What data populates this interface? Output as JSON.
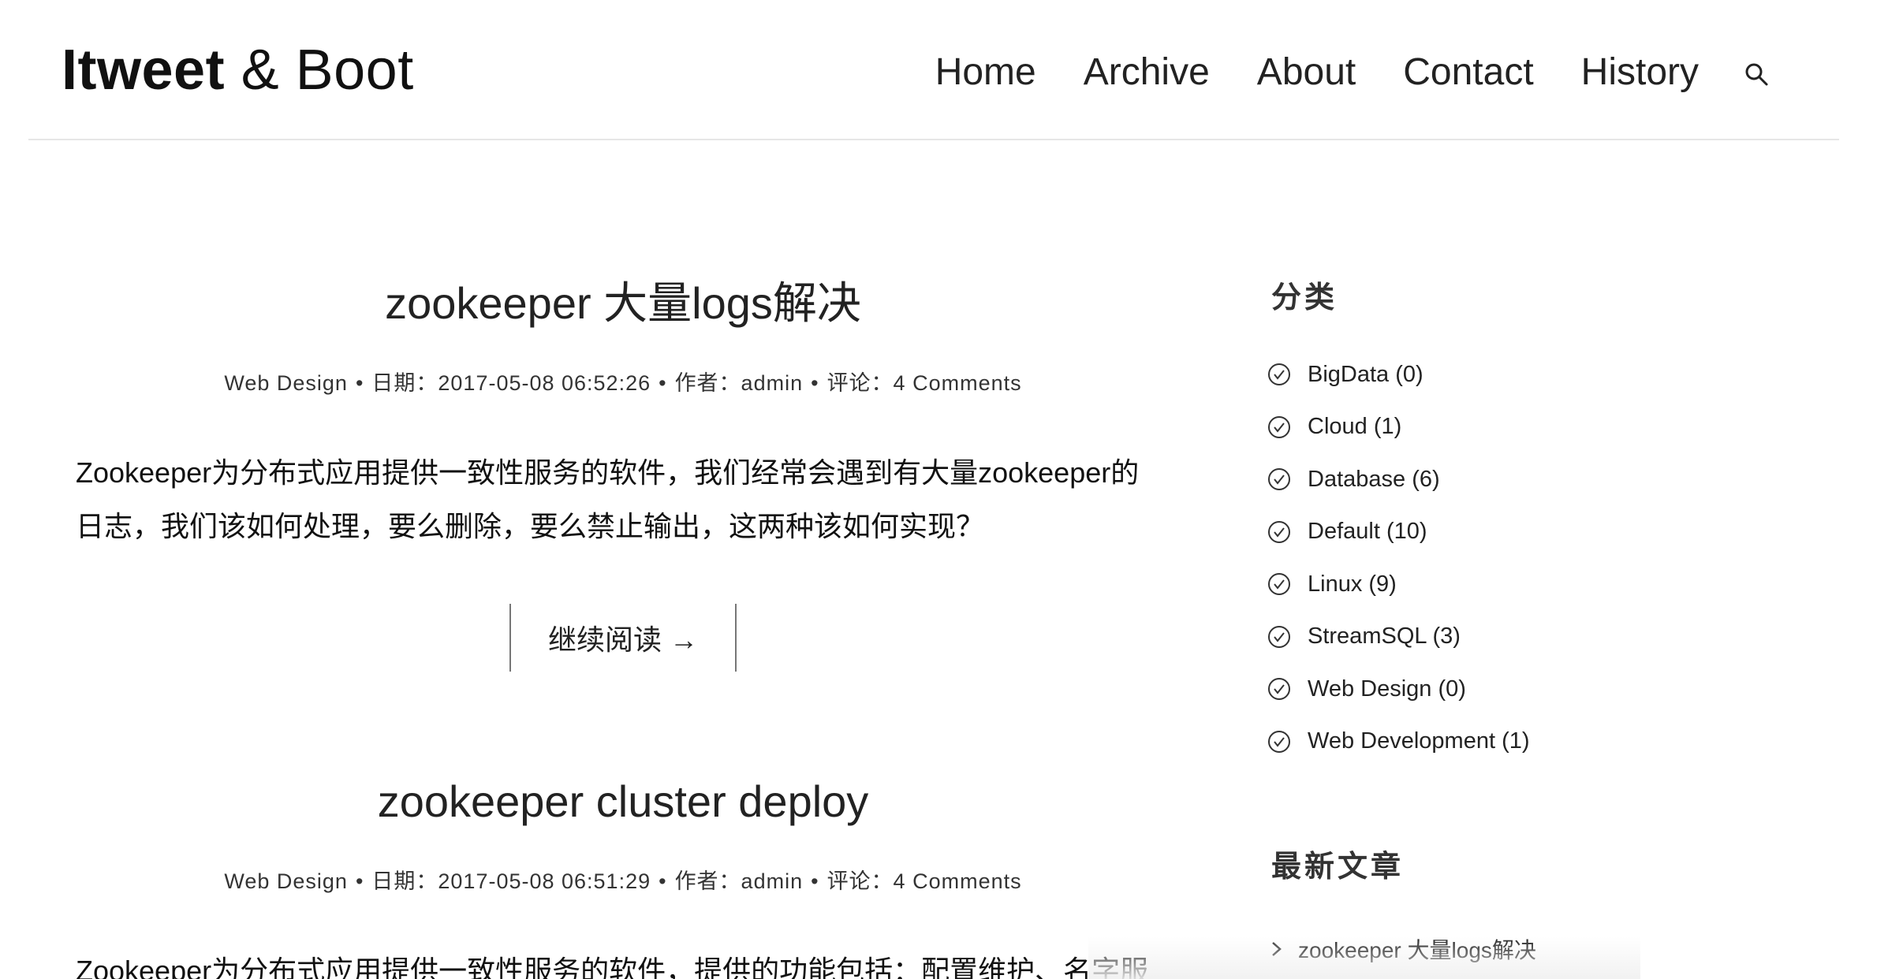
{
  "header": {
    "logo_strong": "Itweet",
    "logo_amp": "&",
    "logo_light": "Boot",
    "nav": [
      "Home",
      "Archive",
      "About",
      "Contact",
      "History"
    ]
  },
  "posts": [
    {
      "title": "zookeeper 大量logs解决",
      "category": "Web Design",
      "date": "日期：2017-05-08 06:52:26",
      "author": "作者：admin",
      "comments": "评论：4 Comments",
      "excerpt_line1": "Zookeeper为分布式应用提供一致性服务的软件，我们经常会遇到有大量zookeeper的",
      "excerpt_line2": "日志，我们该如何处理，要么删除，要么禁止输出，这两种该如何实现？",
      "readmore": "继续阅读 →"
    },
    {
      "title": "zookeeper cluster deploy",
      "category": "Web Design",
      "date": "日期：2017-05-08 06:51:29",
      "author": "作者：admin",
      "comments": "评论：4 Comments",
      "excerpt_line1": "Zookeeper为分布式应用提供一致性服务的软件，提供的功能包括：配置维护、名字服"
    }
  ],
  "sidebar": {
    "categories_title": "分类",
    "categories": [
      "BigData (0)",
      "Cloud (1)",
      "Database (6)",
      "Default (10)",
      "Linux (9)",
      "StreamSQL (3)",
      "Web Design (0)",
      "Web Development (1)"
    ],
    "recent_title": "最新文章",
    "recent": [
      "zookeeper 大量logs解决"
    ]
  }
}
